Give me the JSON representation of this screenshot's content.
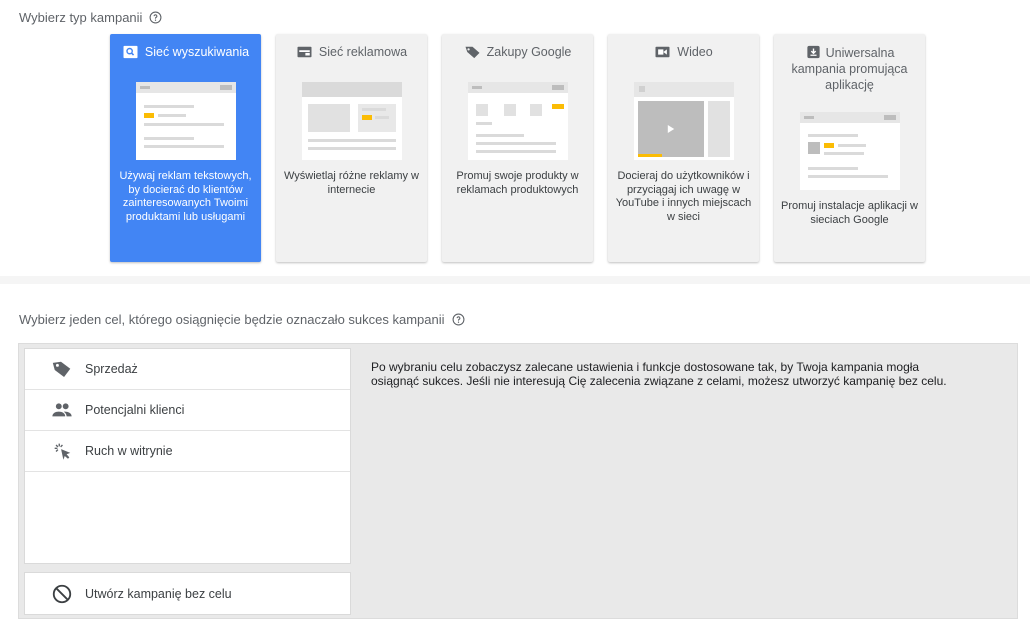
{
  "campaign_type": {
    "title": "Wybierz typ kampanii",
    "cards": [
      {
        "label": "Sieć wyszukiwania",
        "description": "Używaj reklam tekstowych, by docierać do klientów zainteresowanych Twoimi produktami lub usługami",
        "icon": "search-icon",
        "selected": true
      },
      {
        "label": "Sieć reklamowa",
        "description": "Wyświetlaj różne reklamy w internecie",
        "icon": "display-ad-icon",
        "selected": false
      },
      {
        "label": "Zakupy Google",
        "description": "Promuj swoje produkty w reklamach produktowych",
        "icon": "shopping-tag-icon",
        "selected": false
      },
      {
        "label": "Wideo",
        "description": "Docieraj do użytkowników i przyciągaj ich uwagę w YouTube i innych miejscach w sieci",
        "icon": "video-camera-icon",
        "selected": false
      },
      {
        "label": "Uniwersalna kampania promująca aplikację",
        "description": "Promuj instalacje aplikacji w sieciach Google",
        "icon": "download-app-icon",
        "selected": false
      }
    ]
  },
  "goal": {
    "title": "Wybierz jeden cel, którego osiągnięcie będzie oznaczało sukces kampanii",
    "items": [
      {
        "label": "Sprzedaż",
        "icon": "tag-icon"
      },
      {
        "label": "Potencjalni klienci",
        "icon": "people-icon"
      },
      {
        "label": "Ruch w witrynie",
        "icon": "cursor-click-icon"
      }
    ],
    "no_goal_label": "Utwórz kampanię bez celu",
    "info_text": "Po wybraniu celu zobaczysz zalecane ustawienia i funkcje dostosowane tak, by Twoja kampania mogła osiągnąć sukces. Jeśli nie interesują Cię zalecenia związane z celami, możesz utworzyć kampanię bez celu."
  },
  "colors": {
    "accent": "#4285f4",
    "yellow": "#fbbc04"
  }
}
